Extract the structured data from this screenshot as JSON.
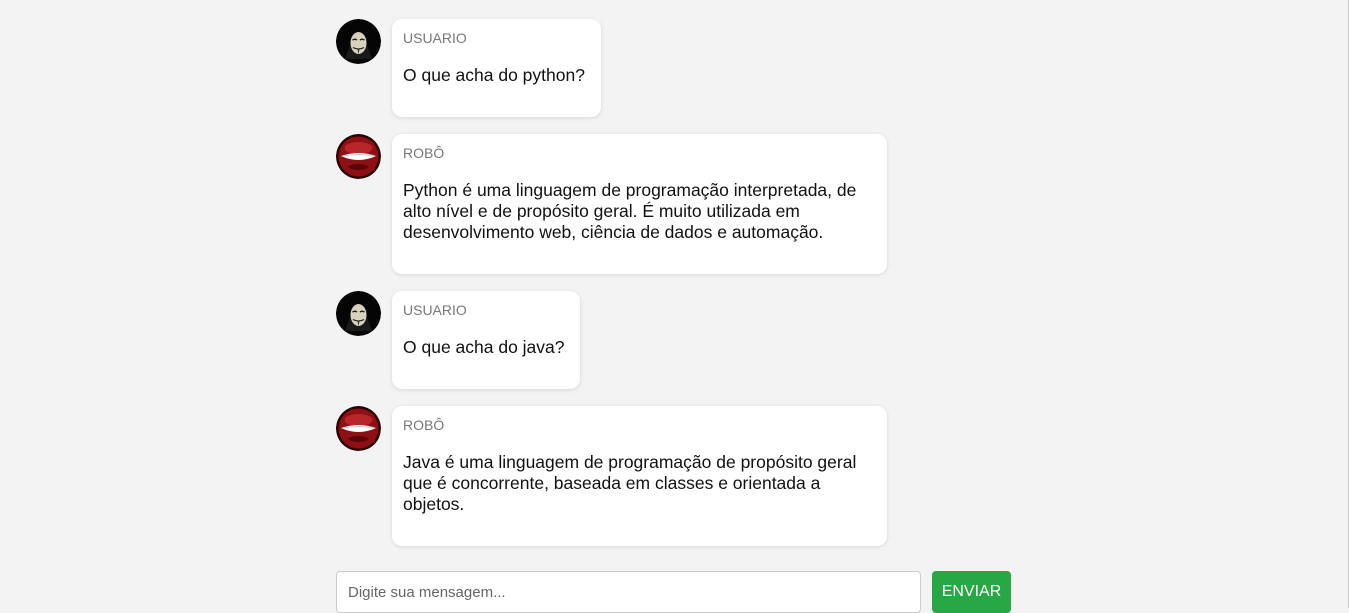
{
  "messages": [
    {
      "author": "USUARIO",
      "avatar": "anonymous-mask-icon",
      "text": "O que acha do python?"
    },
    {
      "author": "ROBÔ",
      "avatar": "robot-face-icon",
      "text": "Python é uma linguagem de programação interpretada, de alto nível e de propósito geral. É muito utilizada em desenvolvimento web, ciência de dados e automação."
    },
    {
      "author": "USUARIO",
      "avatar": "anonymous-mask-icon",
      "text": "O que acha do java?"
    },
    {
      "author": "ROBÔ",
      "avatar": "robot-face-icon",
      "text": "Java é uma linguagem de programação de propósito geral que é concorrente, baseada em classes e orientada a objetos."
    }
  ],
  "composer": {
    "placeholder": "Digite sua mensagem...",
    "value": "",
    "send_label": "ENVIAR"
  },
  "colors": {
    "background": "#f3f3f3",
    "bubble": "#ffffff",
    "send_button": "#28a745"
  }
}
